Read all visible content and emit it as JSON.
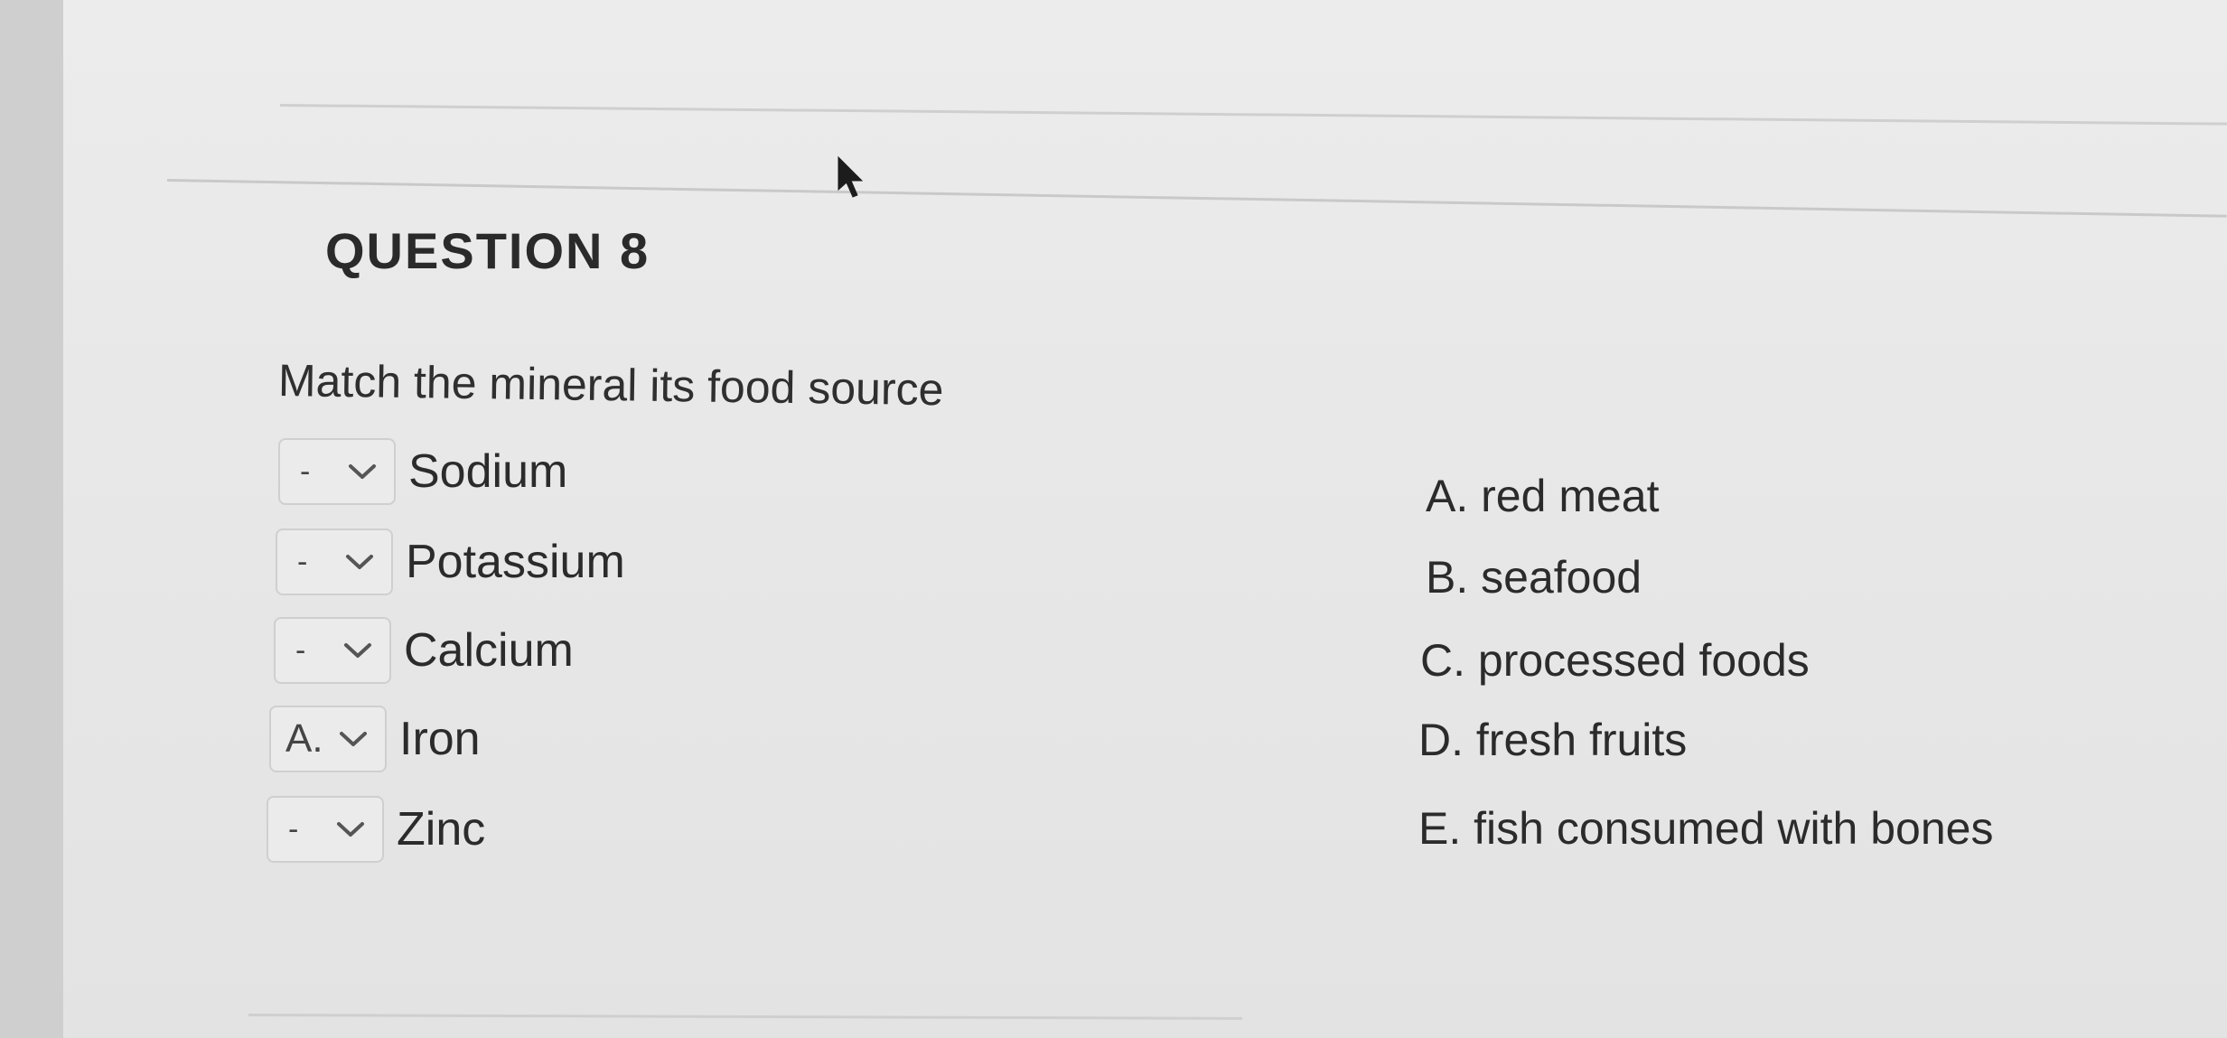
{
  "question": {
    "title": "QUESTION 8",
    "prompt": "Match the mineral its food source"
  },
  "matches": [
    {
      "selected": "-",
      "label": "Sodium"
    },
    {
      "selected": "-",
      "label": "Potassium"
    },
    {
      "selected": "-",
      "label": "Calcium"
    },
    {
      "selected": "A.",
      "label": "Iron"
    },
    {
      "selected": "-",
      "label": "Zinc"
    }
  ],
  "options": [
    {
      "letter": "A.",
      "text": "red meat"
    },
    {
      "letter": "B.",
      "text": "seafood"
    },
    {
      "letter": "C.",
      "text": "processed foods"
    },
    {
      "letter": "D.",
      "text": "fresh fruits"
    },
    {
      "letter": "E.",
      "text": "fish consumed with bones"
    }
  ],
  "icons": {
    "dropdown": "chevron-down-icon",
    "pointer": "mouse-cursor-icon"
  },
  "colors": {
    "background": "#e8e8e8",
    "text": "#2b2b2b",
    "border": "#cfcfcf"
  }
}
